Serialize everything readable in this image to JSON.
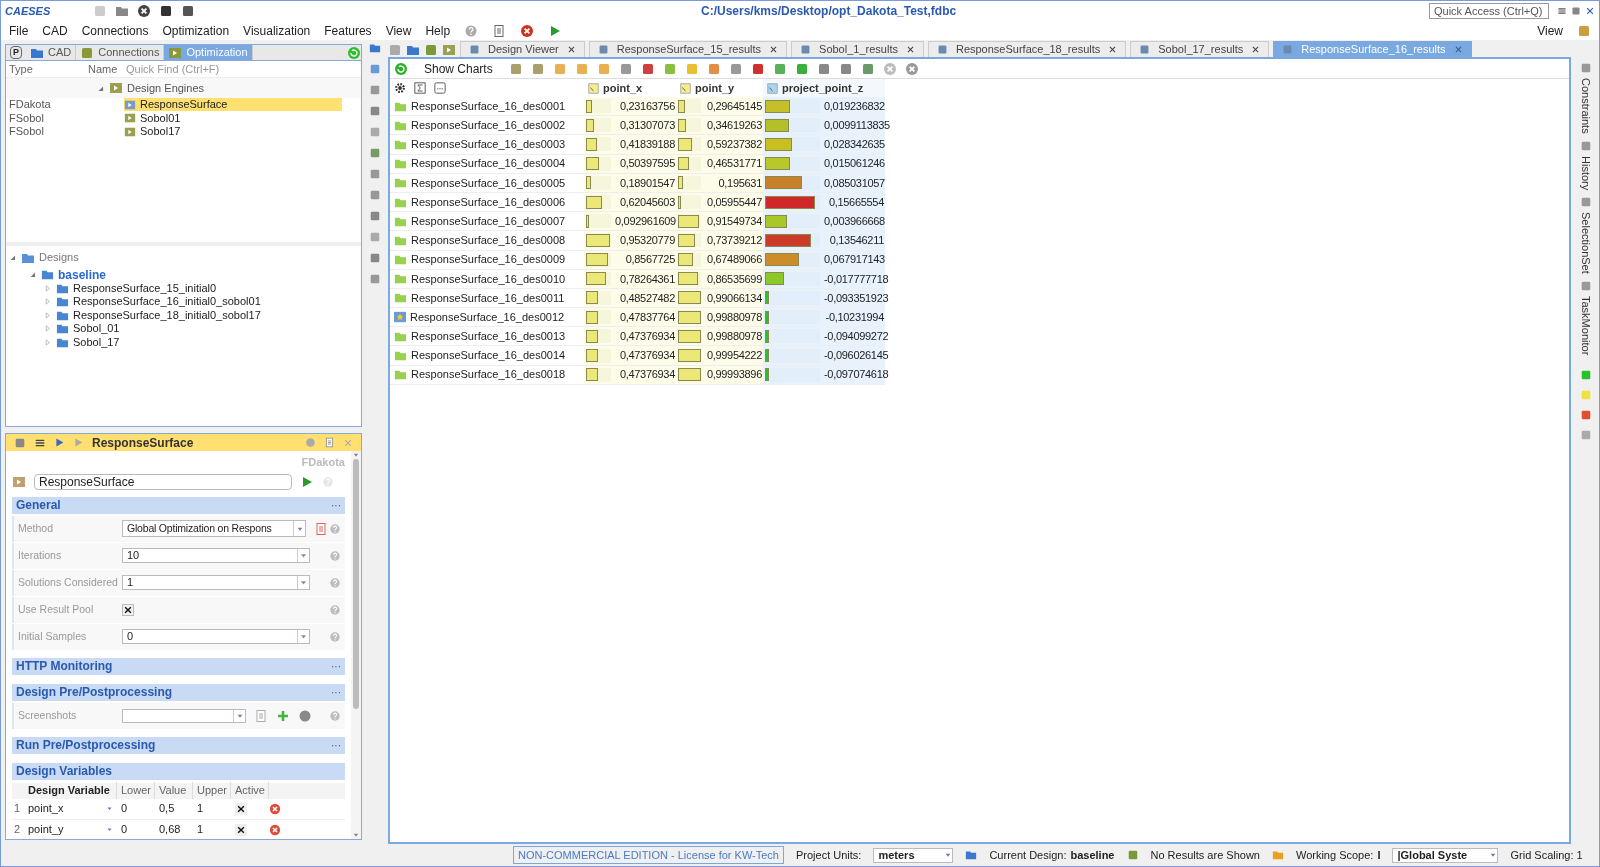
{
  "app": {
    "logo": "CAESES",
    "title": "C:/Users/kms/Desktop/opt_Dakota_Test,fdbc",
    "quick_access": {
      "placeholder": "Quick Access (Ctrl+Q)"
    }
  },
  "menu": [
    "File",
    "CAD",
    "Connections",
    "Optimization",
    "Visualization",
    "Features",
    "View",
    "Help"
  ],
  "perspective": "View",
  "profile_button": "P",
  "left_tabs": [
    {
      "label": "CAD",
      "selected": false
    },
    {
      "label": "Connections",
      "selected": false
    },
    {
      "label": "Optimization",
      "selected": true
    }
  ],
  "tree_columns": [
    "Type",
    "Name"
  ],
  "quick_find": {
    "placeholder": "Quick Find (Ctrl+F)"
  },
  "design_engines": {
    "label": "Design Engines",
    "expanded": true,
    "items": [
      {
        "type": "FDakota",
        "name": "ResponseSurface",
        "selected": true
      },
      {
        "type": "FSobol",
        "name": "Sobol01",
        "selected": false
      },
      {
        "type": "FSobol",
        "name": "Sobol17",
        "selected": false
      }
    ]
  },
  "designs": {
    "label": "Designs",
    "expanded": true,
    "children": [
      {
        "label": "baseline",
        "expanded": true,
        "children": [
          {
            "label": "ResponseSurface_15_initial0",
            "expanded": false
          },
          {
            "label": "ResponseSurface_16_initial0_sobol01",
            "expanded": false
          },
          {
            "label": "ResponseSurface_18_initial0_sobol17",
            "expanded": false
          },
          {
            "label": "Sobol_01",
            "expanded": false
          },
          {
            "label": "Sobol_17",
            "expanded": false
          }
        ]
      }
    ]
  },
  "properties": {
    "title": "ResponseSurface",
    "type": "FDakota",
    "name": "ResponseSurface",
    "sections": [
      {
        "title": "General",
        "more": "···",
        "rows": [
          {
            "kind": "select",
            "label": "Method",
            "value": "Global Optimization on Respons"
          },
          {
            "kind": "spin",
            "label": "Iterations",
            "value": "10"
          },
          {
            "kind": "spin",
            "label": "Solutions Considered",
            "value": "1"
          },
          {
            "kind": "checkbox",
            "label": "Use Result Pool",
            "checked": true
          },
          {
            "kind": "spin",
            "label": "Initial Samples",
            "value": "0"
          }
        ]
      },
      {
        "title": "HTTP Monitoring",
        "more": "···"
      },
      {
        "title": "Design Pre/Postprocessing",
        "more": "···",
        "rows": [
          {
            "kind": "screenshots",
            "label": "Screenshots"
          }
        ]
      },
      {
        "title": "Run Pre/Postprocessing",
        "more": "···"
      }
    ],
    "variables": {
      "title": "Design Variables",
      "columns": [
        "Design Variable",
        "Lower",
        "Value",
        "Upper",
        "Active"
      ],
      "rows": [
        {
          "index": "1",
          "name": "point_x",
          "lower": "0",
          "value": "0,5",
          "upper": "1",
          "active": true
        },
        {
          "index": "2",
          "name": "point_y",
          "lower": "0",
          "value": "0,68",
          "upper": "1",
          "active": true
        }
      ]
    }
  },
  "editor_tabs": [
    {
      "label": "Design Viewer",
      "selected": false
    },
    {
      "label": "ResponseSurface_15_results",
      "selected": false
    },
    {
      "label": "Sobol_1_results",
      "selected": false
    },
    {
      "label": "ResponseSurface_18_results",
      "selected": false
    },
    {
      "label": "Sobol_17_results",
      "selected": false
    },
    {
      "label": "ResponseSurface_16_results",
      "selected": true
    }
  ],
  "show_charts": "Show Charts",
  "table": {
    "columns": [
      "point_x",
      "point_y",
      "project_point_z"
    ],
    "rows": [
      {
        "name": "ResponseSurface_16_des0001",
        "starred": false,
        "cells": [
          {
            "value": "0,23163756",
            "level": 0.23
          },
          {
            "value": "0,29645145",
            "level": 0.3
          },
          {
            "value": "0,019236832",
            "level": 0.45,
            "color": "#c4c02a"
          }
        ]
      },
      {
        "name": "ResponseSurface_16_des0002",
        "starred": false,
        "cells": [
          {
            "value": "0,31307073",
            "level": 0.31
          },
          {
            "value": "0,34619263",
            "level": 0.35
          },
          {
            "value": "0,0099113835",
            "level": 0.44,
            "color": "#b4c02a"
          }
        ]
      },
      {
        "name": "ResponseSurface_16_des0003",
        "starred": false,
        "cells": [
          {
            "value": "0,41839188",
            "level": 0.42
          },
          {
            "value": "0,59237382",
            "level": 0.59
          },
          {
            "value": "0,028342635",
            "level": 0.49,
            "color": "#c8c020"
          }
        ]
      },
      {
        "name": "ResponseSurface_16_des0004",
        "starred": false,
        "cells": [
          {
            "value": "0,50397595",
            "level": 0.5
          },
          {
            "value": "0,46531771",
            "level": 0.47
          },
          {
            "value": "0,015061246",
            "level": 0.45,
            "color": "#b8c82a"
          }
        ]
      },
      {
        "name": "ResponseSurface_16_des0005",
        "starred": false,
        "cells": [
          {
            "value": "0,18901547",
            "level": 0.19
          },
          {
            "value": "0,195631",
            "level": 0.2
          },
          {
            "value": "0,085031057",
            "level": 0.67,
            "color": "#c8802a"
          }
        ]
      },
      {
        "name": "ResponseSurface_16_des0006",
        "starred": false,
        "cells": [
          {
            "value": "0,62045603",
            "level": 0.62
          },
          {
            "value": "0,05955447",
            "level": 0.06
          },
          {
            "value": "0,15665554",
            "level": 0.91,
            "color": "#d02828"
          }
        ]
      },
      {
        "name": "ResponseSurface_16_des0007",
        "starred": false,
        "cells": [
          {
            "value": "0,092961609",
            "level": 0.09
          },
          {
            "value": "0,91549734",
            "level": 0.92
          },
          {
            "value": "0,003966668",
            "level": 0.4,
            "color": "#a8c82a"
          }
        ]
      },
      {
        "name": "ResponseSurface_16_des0008",
        "starred": false,
        "cells": [
          {
            "value": "0,95320779",
            "level": 0.95
          },
          {
            "value": "0,73739212",
            "level": 0.74
          },
          {
            "value": "0,13546211",
            "level": 0.84,
            "color": "#cc3a28"
          }
        ]
      },
      {
        "name": "ResponseSurface_16_des0009",
        "starred": false,
        "cells": [
          {
            "value": "0,8567725",
            "level": 0.86
          },
          {
            "value": "0,67489066",
            "level": 0.67
          },
          {
            "value": "0,067917143",
            "level": 0.62,
            "color": "#cc8c28"
          }
        ]
      },
      {
        "name": "ResponseSurface_16_des0010",
        "starred": false,
        "cells": [
          {
            "value": "0,78264361",
            "level": 0.78
          },
          {
            "value": "0,86535699",
            "level": 0.87
          },
          {
            "value": "-0,017777718",
            "level": 0.35,
            "color": "#8cc828"
          }
        ]
      },
      {
        "name": "ResponseSurface_16_des0011",
        "starred": false,
        "cells": [
          {
            "value": "0,48527482",
            "level": 0.49
          },
          {
            "value": "0,99066134",
            "level": 0.99
          },
          {
            "value": "-0,093351923",
            "level": 0.07,
            "color": "#28c828"
          }
        ]
      },
      {
        "name": "ResponseSurface_16_des0012",
        "starred": true,
        "cells": [
          {
            "value": "0,47837764",
            "level": 0.48
          },
          {
            "value": "0,99880978",
            "level": 1
          },
          {
            "value": "-0,10231994",
            "level": 0.07,
            "color": "#22c422"
          }
        ]
      },
      {
        "name": "ResponseSurface_16_des0013",
        "starred": false,
        "cells": [
          {
            "value": "0,47376934",
            "level": 0.47
          },
          {
            "value": "0,99880978",
            "level": 1
          },
          {
            "value": "-0,094099272",
            "level": 0.07,
            "color": "#26c626"
          }
        ]
      },
      {
        "name": "ResponseSurface_16_des0014",
        "starred": false,
        "cells": [
          {
            "value": "0,47376934",
            "level": 0.47
          },
          {
            "value": "0,99954222",
            "level": 1
          },
          {
            "value": "-0,096026145",
            "level": 0.07,
            "color": "#24c524"
          }
        ]
      },
      {
        "name": "ResponseSurface_16_des0018",
        "starred": false,
        "cells": [
          {
            "value": "0,47376934",
            "level": 0.47
          },
          {
            "value": "0,99993896",
            "level": 1
          },
          {
            "value": "-0,097074618",
            "level": 0.07,
            "color": "#23c423"
          }
        ]
      }
    ]
  },
  "side_tabs": [
    "Constraints",
    "History",
    "SelectionSet",
    "TaskMonitor"
  ],
  "status_bar": {
    "license": "NON-COMMERCIAL EDITION - License for KW-Tech",
    "units_label": "Project Units:",
    "units": "meters",
    "design_label": "Current Design:",
    "design": "baseline",
    "results": "No Results are Shown",
    "scope_label": "Working Scope:",
    "scope": "I",
    "system": "|Global Syste",
    "grid": "Grid Scaling: 1"
  }
}
